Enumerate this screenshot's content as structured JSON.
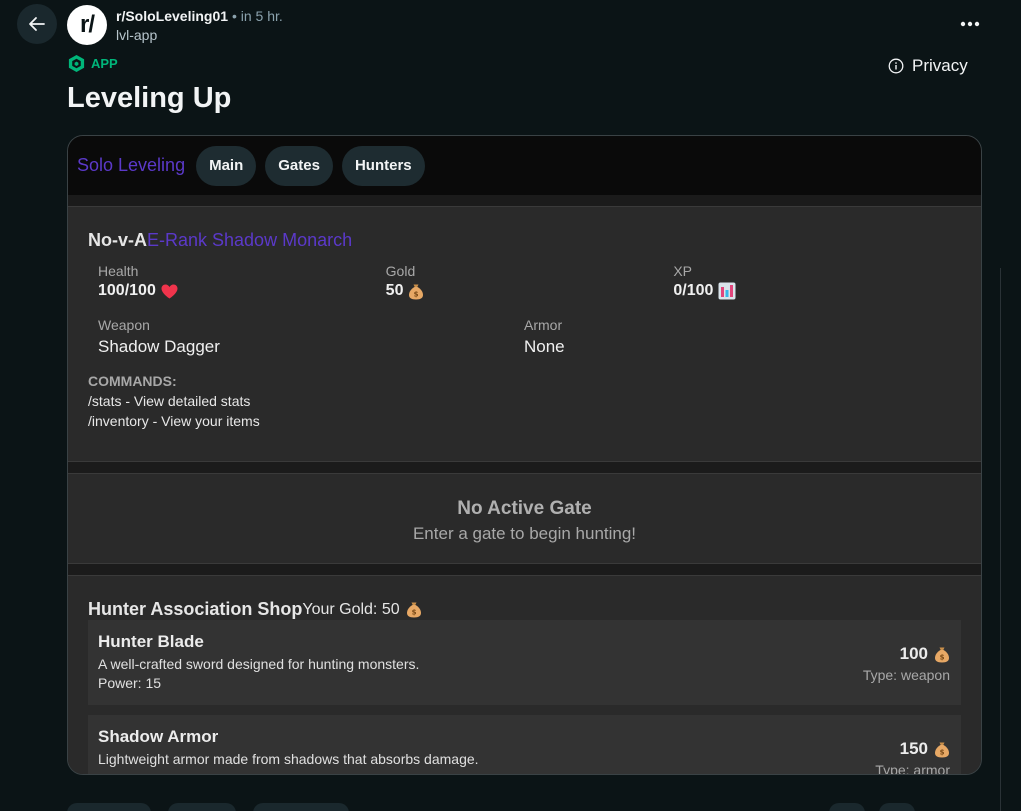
{
  "header": {
    "subreddit": "r/SoloLeveling01",
    "separator": "•",
    "time": "in 5 hr.",
    "author": "lvl-app",
    "avatar_text": "r/"
  },
  "badge": {
    "label": "APP",
    "color": "#00b67a"
  },
  "privacy_label": "Privacy",
  "post_title": "Leveling Up",
  "app": {
    "brand": "Solo Leveling",
    "brand_color": "#5b39c9",
    "nav": [
      "Main",
      "Gates",
      "Hunters"
    ],
    "profile": {
      "name": "No-v-A",
      "rank": "E-Rank Shadow Monarch",
      "stats": [
        {
          "label": "Health",
          "value": "100/100",
          "icon": "heart-icon"
        },
        {
          "label": "Gold",
          "value": "50",
          "icon": "moneybag-icon"
        },
        {
          "label": "XP",
          "value": "0/100",
          "icon": "bar-chart-icon"
        }
      ],
      "weapon_label": "Weapon",
      "weapon": "Shadow Dagger",
      "armor_label": "Armor",
      "armor": "None",
      "commands_title": "COMMANDS:",
      "commands": [
        "/stats - View detailed stats",
        "/inventory - View your items"
      ]
    },
    "gate": {
      "title": "No Active Gate",
      "subtitle": "Enter a gate to begin hunting!"
    },
    "shop": {
      "title": "Hunter Association Shop",
      "gold_text": "Your Gold: 50",
      "items": [
        {
          "name": "Hunter Blade",
          "desc": "A well-crafted sword designed for hunting monsters.",
          "power": "Power: 15",
          "price": "100",
          "type": "Type: weapon"
        },
        {
          "name": "Shadow Armor",
          "desc": "Lightweight armor made from shadows that absorbs damage.",
          "price": "150",
          "type": "Type: armor"
        }
      ]
    }
  }
}
